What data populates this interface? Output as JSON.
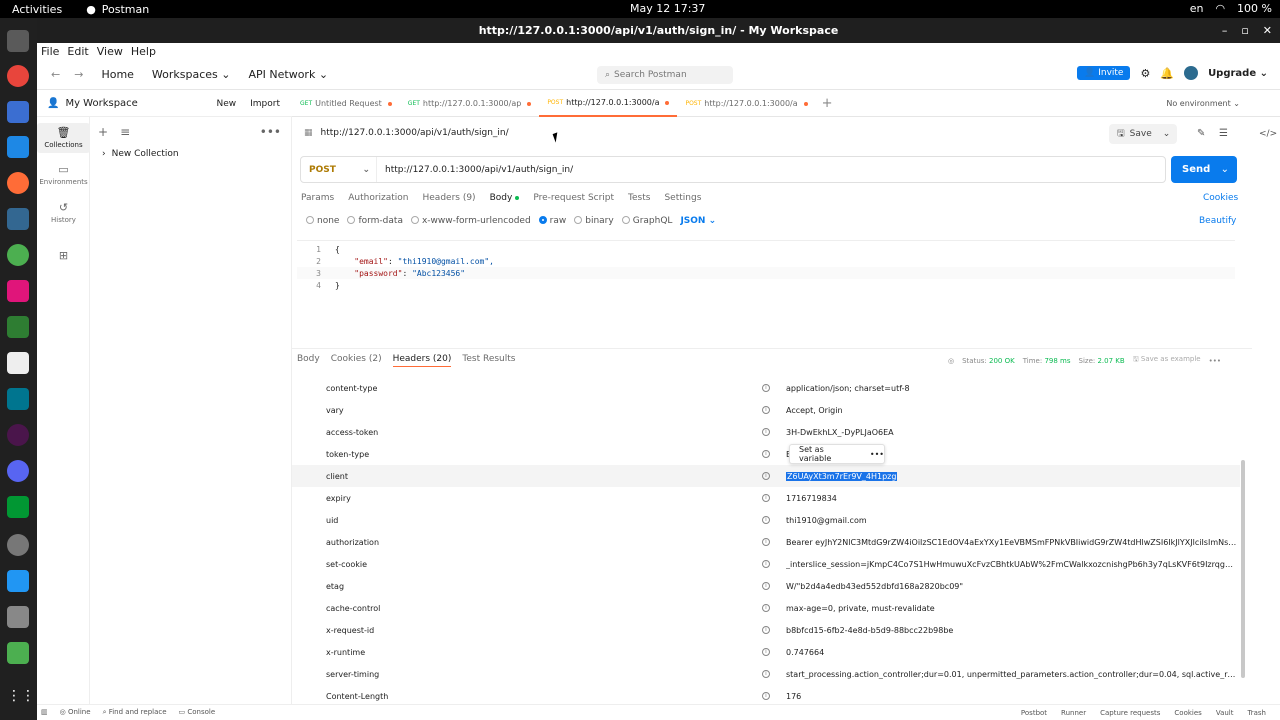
{
  "os_bar": {
    "activities": "Activities",
    "app_name": "Postman",
    "datetime": "May 12  17:37",
    "lang": "en",
    "battery": "100 %"
  },
  "window": {
    "title": "http://127.0.0.1:3000/api/v1/auth/sign_in/ - My Workspace"
  },
  "menu": [
    "File",
    "Edit",
    "View",
    "Help"
  ],
  "header": {
    "home": "Home",
    "workspaces": "Workspaces",
    "api_network": "API Network",
    "search_placeholder": "Search Postman",
    "invite": "Invite",
    "upgrade": "Upgrade"
  },
  "workspace": {
    "name": "My Workspace",
    "new": "New",
    "import": "Import"
  },
  "rail": {
    "collections": "Collections",
    "environments": "Environments",
    "history": "History"
  },
  "collection": {
    "name": "New Collection"
  },
  "tabs": [
    {
      "method": "GET",
      "label": "Untitled Request"
    },
    {
      "method": "GET",
      "label": "http://127.0.0.1:3000/ap"
    },
    {
      "method": "POST",
      "label": "http://127.0.0.1:3000/a"
    },
    {
      "method": "POST",
      "label": "http://127.0.0.1:3000/a"
    }
  ],
  "environment": "No environment",
  "request": {
    "title": "http://127.0.0.1:3000/api/v1/auth/sign_in/",
    "save": "Save",
    "method": "POST",
    "url": "http://127.0.0.1:3000/api/v1/auth/sign_in/",
    "send": "Send",
    "tabs": [
      "Params",
      "Authorization",
      "Headers (9)",
      "Body",
      "Pre-request Script",
      "Tests",
      "Settings"
    ],
    "cookies": "Cookies",
    "body_types": [
      "none",
      "form-data",
      "x-www-form-urlencoded",
      "raw",
      "binary",
      "GraphQL"
    ],
    "format": "JSON",
    "beautify": "Beautify",
    "body_lines": [
      {
        "n": "1",
        "text": "{"
      },
      {
        "n": "2",
        "key": "\"email\"",
        "val": "\"thi1910@gmail.com\","
      },
      {
        "n": "3",
        "key": "\"password\"",
        "val": "\"Abc123456\""
      },
      {
        "n": "4",
        "text": "}"
      }
    ]
  },
  "response": {
    "tabs": [
      "Body",
      "Cookies (2)",
      "Headers (20)",
      "Test Results"
    ],
    "status_label": "Status:",
    "status": "200 OK",
    "time_label": "Time:",
    "time": "798 ms",
    "size_label": "Size:",
    "size": "2.07 KB",
    "save_example": "Save as example",
    "headers": [
      {
        "k": "content-type",
        "v": "application/json; charset=utf-8"
      },
      {
        "k": "vary",
        "v": "Accept, Origin"
      },
      {
        "k": "access-token",
        "v": "3H-DwEkhLX_-DyPLJaO6EA"
      },
      {
        "k": "token-type",
        "v": "Bearer"
      },
      {
        "k": "client",
        "v": "Z6UAyXt3m7rEr9V_4H1pzg"
      },
      {
        "k": "expiry",
        "v": "1716719834"
      },
      {
        "k": "uid",
        "v": "thi1910@gmail.com"
      },
      {
        "k": "authorization",
        "v": "Bearer eyJhY2NlC3MtdG9rZW4iOiIzSC1EdOV4aExYXy1EeVBMSmFPNkVBIiwidG9rZW4tdHlwZSI6IkJlYXJlciIsImNsaWV..."
      },
      {
        "k": "set-cookie",
        "v": "_interslice_session=jKmpC4Co7S1HwHmuwuXcFvzCBhtkUAbW%2FmCWalkxozcnishgPb6h3y7qLsKVF6t9IzrqgDqKbP..."
      },
      {
        "k": "etag",
        "v": "W/\"b2d4a4edb43ed552dbfd168a2820bc09\""
      },
      {
        "k": "cache-control",
        "v": "max-age=0, private, must-revalidate"
      },
      {
        "k": "x-request-id",
        "v": "b8bfcd15-6fb2-4e8d-b5d9-88bcc22b98be"
      },
      {
        "k": "x-runtime",
        "v": "0.747664"
      },
      {
        "k": "server-timing",
        "v": "start_processing.action_controller;dur=0.01, unpermitted_parameters.action_controller;dur=0.04, sql.active_record;du..."
      },
      {
        "k": "Content-Length",
        "v": "176"
      }
    ],
    "popover_label": "Set as variable"
  },
  "statusbar": {
    "online": "Online",
    "find": "Find and replace",
    "console": "Console",
    "postbot": "Postbot",
    "runner": "Runner",
    "capture": "Capture requests",
    "cookies": "Cookies",
    "vault": "Vault",
    "trash": "Trash"
  }
}
